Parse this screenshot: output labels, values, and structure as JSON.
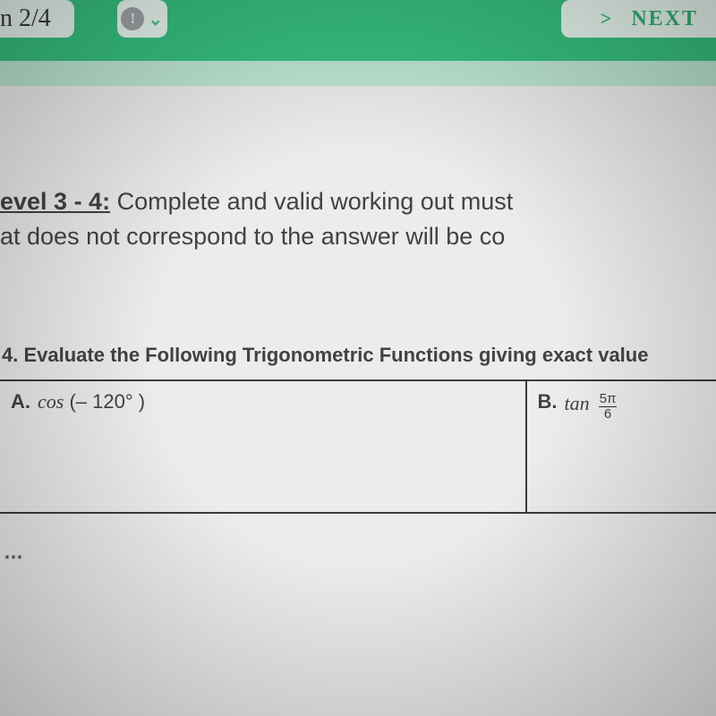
{
  "topbar": {
    "progress_label": "n 2/4",
    "alert_glyph": "!",
    "chev_down": "⌄",
    "next_chev": ">",
    "next_label": "NEXT"
  },
  "instructions": {
    "level_label": "evel 3 - 4:",
    "line1_rest": " Complete and valid working out must",
    "line2": "at does not correspond to the answer will be co"
  },
  "question": {
    "title": "4. Evaluate the Following Trigonometric Functions giving exact value",
    "a_letter": "A.",
    "a_func": "cos",
    "a_arg": "(– 120° )",
    "b_letter": "B.",
    "b_func": "tan",
    "b_frac_num": "5π",
    "b_frac_den": "6"
  },
  "bottom_smudge": "…"
}
